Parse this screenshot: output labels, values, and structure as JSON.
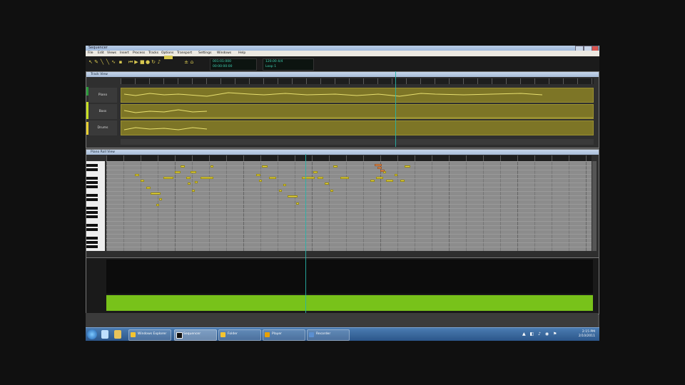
{
  "window": {
    "title": "Sequencer"
  },
  "menu": [
    "File",
    "Edit",
    "Views",
    "Insert",
    "Process",
    "Tracks",
    "Options",
    "Transport",
    "Settings",
    "Windows",
    "Help"
  ],
  "lcd": {
    "a_top": "001:01:000",
    "a_bottom": "00:00:00:00",
    "b_top": "120.00 4/4",
    "b_bottom": "Loop 1"
  },
  "track_pane": {
    "title": "Track View"
  },
  "tracks": [
    {
      "name": "Piano"
    },
    {
      "name": "Bass"
    },
    {
      "name": "Drums"
    }
  ],
  "piano_pane": {
    "title": "Piano Roll View"
  },
  "taskbar": {
    "buttons": [
      {
        "label": "Windows Explorer",
        "color": "#f4c430"
      },
      {
        "label": "Sequencer",
        "color": "#222222"
      },
      {
        "label": "Folder",
        "color": "#f4c430"
      },
      {
        "label": "Player",
        "color": "#e8a000"
      },
      {
        "label": "Recorder",
        "color": "#5b8fd0"
      }
    ],
    "clock_time": "2:15 PM",
    "clock_date": "2/10/2011"
  },
  "colors": {
    "accent": "#27b4a8",
    "track_lane": "#7d7526",
    "note": "#e8d84a",
    "velocity": "#78c21a"
  }
}
